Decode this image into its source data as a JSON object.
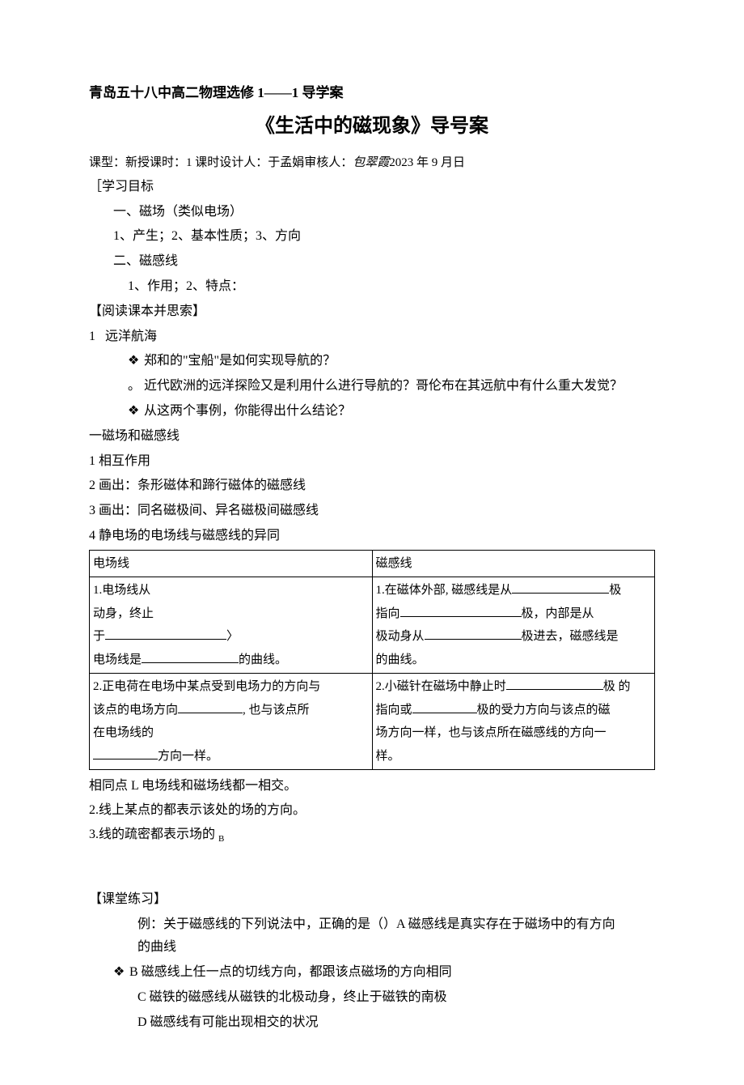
{
  "header": "青岛五十八中高二物理选修 1——1 导学案",
  "title": "《生活中的磁现象》导号案",
  "meta": {
    "prefix": "课型：新授课时：1 课时设计人：于孟娟审核人：",
    "checker": "包翠霞",
    "date": "2023 年 9 月日"
  },
  "objectives_label": "［学习目标",
  "obj1": "一、磁场（类似电场）",
  "obj1_items": "1、产生；2、基本性质；3、方向",
  "obj2": "二、磁感线",
  "obj2_items": "1、作用；2、特点：",
  "read_label": "【阅读课本并思索】",
  "q1_num": "1",
  "q1_title": "远洋航海",
  "q1_a": "郑和的\"宝船\"是如何实现导航的？",
  "q1_b": "近代欧洲的远洋探险又是利用什么进行导航的？哥伦布在其远航中有什么重大发觉？",
  "q1_c": "从这两个事例，你能得出什么结论？",
  "sec1_title": "一磁场和磁感线",
  "sec1_1": "1 相互作用",
  "sec1_2": "2 画出：条形磁体和蹄行磁体的磁感线",
  "sec1_3": "3 画出：同名磁极间、异名磁极间磁感线",
  "sec1_4": "4 静电场的电场线与磁感线的异同",
  "table": {
    "h1": "电场线",
    "h2": "磁感线",
    "r1c1_a": "1.电场线从",
    "r1c1_b": "动身，终止",
    "r1c1_c": "于",
    "r1c1_d": "电场线是",
    "r1c1_e": "的曲线。",
    "r1c2_a": "1.在磁体外部, 磁感线是从",
    "r1c2_b": "极",
    "r1c2_c": "指向",
    "r1c2_d": "极，内部是从",
    "r1c2_e": "极动身从",
    "r1c2_f": "极进去，磁感线是",
    "r1c2_g": "的曲线。",
    "r2c1_a": "2.正电荷在电场中某点受到电场力的方向与",
    "r2c1_b": "该点的电场方向",
    "r2c1_c": ", 也与该点所",
    "r2c1_d": "在电场线的",
    "r2c1_e": "方向一样。",
    "r2c2_a": "2.小磁针在磁场中静止时",
    "r2c2_b": "极 的",
    "r2c2_c": "指向或",
    "r2c2_d": "极的受力方向与该点的磁",
    "r2c2_e": "场方向一样，也与该点所在磁感线的方向一",
    "r2c2_f": "样。"
  },
  "same_1": "相同点 L 电场线和磁场线都一相交。",
  "same_2": "2.线上某点的都表示该处的场的方向。",
  "same_3_a": "3.线的疏密都表示场的 ",
  "same_3_b": "B",
  "exercise_label": "【课堂练习】",
  "ex_stem_a": "例：关于磁感线的下列说法中，正确的是（）A 磁感线是真实存在于磁场中的有方向",
  "ex_stem_b": "的曲线",
  "ex_b": "B 磁感线上任一点的切线方向，都跟该点磁场的方向相同",
  "ex_c": "C 磁铁的磁感线从磁铁的北极动身，终止于磁铁的南极",
  "ex_d": "D 磁感线有可能出现相交的状况"
}
